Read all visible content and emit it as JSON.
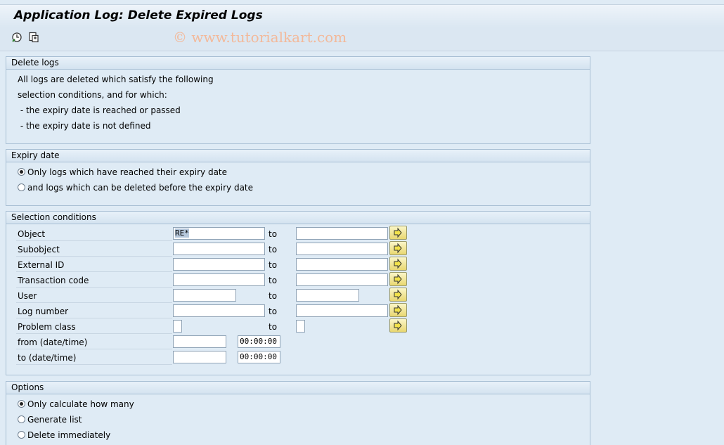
{
  "title": "Application Log: Delete Expired Logs",
  "watermark": "© www.tutorialkart.com",
  "toolbar": {
    "icons": [
      "execute-icon",
      "save-variant-icon"
    ]
  },
  "delete_logs": {
    "header": "Delete logs",
    "lines": [
      "All logs are deleted which satisfy the following",
      "selection conditions, and for which:",
      " - the expiry date is reached or passed",
      " - the expiry date is not defined"
    ]
  },
  "expiry": {
    "header": "Expiry date",
    "opt1": "Only logs which have reached their expiry date",
    "opt2": "and logs which can be deleted before the expiry date",
    "selected": 1
  },
  "selection": {
    "header": "Selection conditions",
    "to_label": "to",
    "rows": [
      {
        "label": "Object",
        "from": "RE*",
        "to": ""
      },
      {
        "label": "Subobject",
        "from": "",
        "to": ""
      },
      {
        "label": "External ID",
        "from": "",
        "to": ""
      },
      {
        "label": "Transaction code",
        "from": "",
        "to": ""
      },
      {
        "label": "User",
        "from": "",
        "to": ""
      },
      {
        "label": "Log number",
        "from": "",
        "to": ""
      },
      {
        "label": "Problem class",
        "from": "",
        "to": ""
      },
      {
        "label": "from (date/time)",
        "date": "",
        "time": "00:00:00"
      },
      {
        "label": "to (date/time)",
        "date": "",
        "time": "00:00:00"
      }
    ]
  },
  "options": {
    "header": "Options",
    "opt1": "Only calculate how many",
    "opt2": "Generate list",
    "opt3": "Delete immediately",
    "selected": 1
  },
  "colors": {
    "accent": "#dfebf5",
    "button": "#e9d770"
  }
}
